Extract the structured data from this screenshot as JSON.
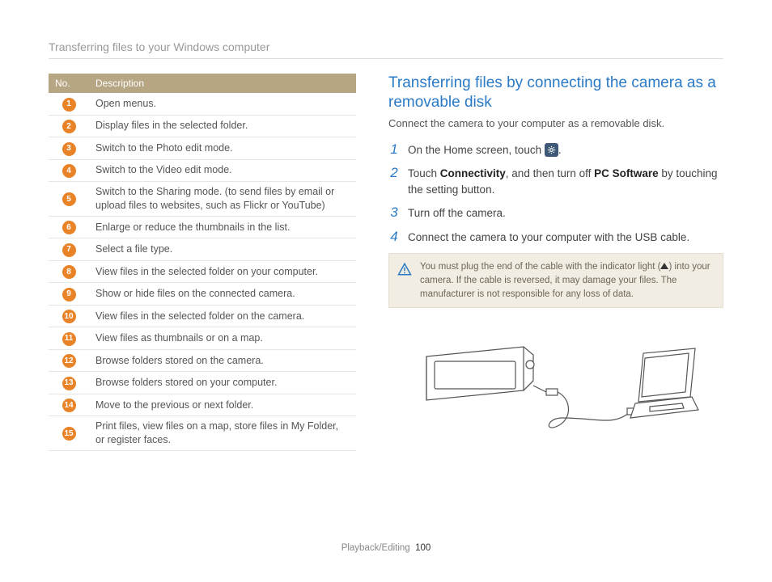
{
  "header": "Transferring files to your Windows computer",
  "table": {
    "col_no": "No.",
    "col_desc": "Description",
    "rows": [
      {
        "n": "1",
        "d": "Open menus."
      },
      {
        "n": "2",
        "d": "Display files in the selected folder."
      },
      {
        "n": "3",
        "d": "Switch to the Photo edit mode."
      },
      {
        "n": "4",
        "d": "Switch to the Video edit mode."
      },
      {
        "n": "5",
        "d": "Switch to the Sharing mode. (to send files by email or upload files to websites, such as Flickr or YouTube)"
      },
      {
        "n": "6",
        "d": "Enlarge or reduce the thumbnails in the list."
      },
      {
        "n": "7",
        "d": "Select a file type."
      },
      {
        "n": "8",
        "d": "View files in the selected folder on your computer."
      },
      {
        "n": "9",
        "d": "Show or hide files on the connected camera."
      },
      {
        "n": "10",
        "d": "View files in the selected folder on the camera."
      },
      {
        "n": "11",
        "d": "View files as thumbnails or on a map."
      },
      {
        "n": "12",
        "d": "Browse folders stored on the camera."
      },
      {
        "n": "13",
        "d": "Browse folders stored on your computer."
      },
      {
        "n": "14",
        "d": "Move to the previous or next folder."
      },
      {
        "n": "15",
        "d": "Print files, view files on a map, store files in My Folder, or register faces."
      }
    ]
  },
  "section": {
    "heading": "Transferring files by connecting the camera as a removable disk",
    "sub": "Connect the camera to your computer as a removable disk.",
    "steps": {
      "s1_pre": "On the Home screen, touch ",
      "s1_post": ".",
      "s2_a": "Touch ",
      "s2_b": "Connectivity",
      "s2_c": ", and then turn off ",
      "s2_d": "PC Software",
      "s2_e": " by touching the setting button.",
      "s3": "Turn off the camera.",
      "s4": "Connect the camera to your computer with the USB cable."
    },
    "callout_a": "You must plug the end of the cable with the indicator light (",
    "callout_b": ") into your camera. If the cable is reversed, it may damage your files. The manufacturer is not responsible for any loss of data."
  },
  "footer": {
    "section": "Playback/Editing",
    "page": "100"
  }
}
